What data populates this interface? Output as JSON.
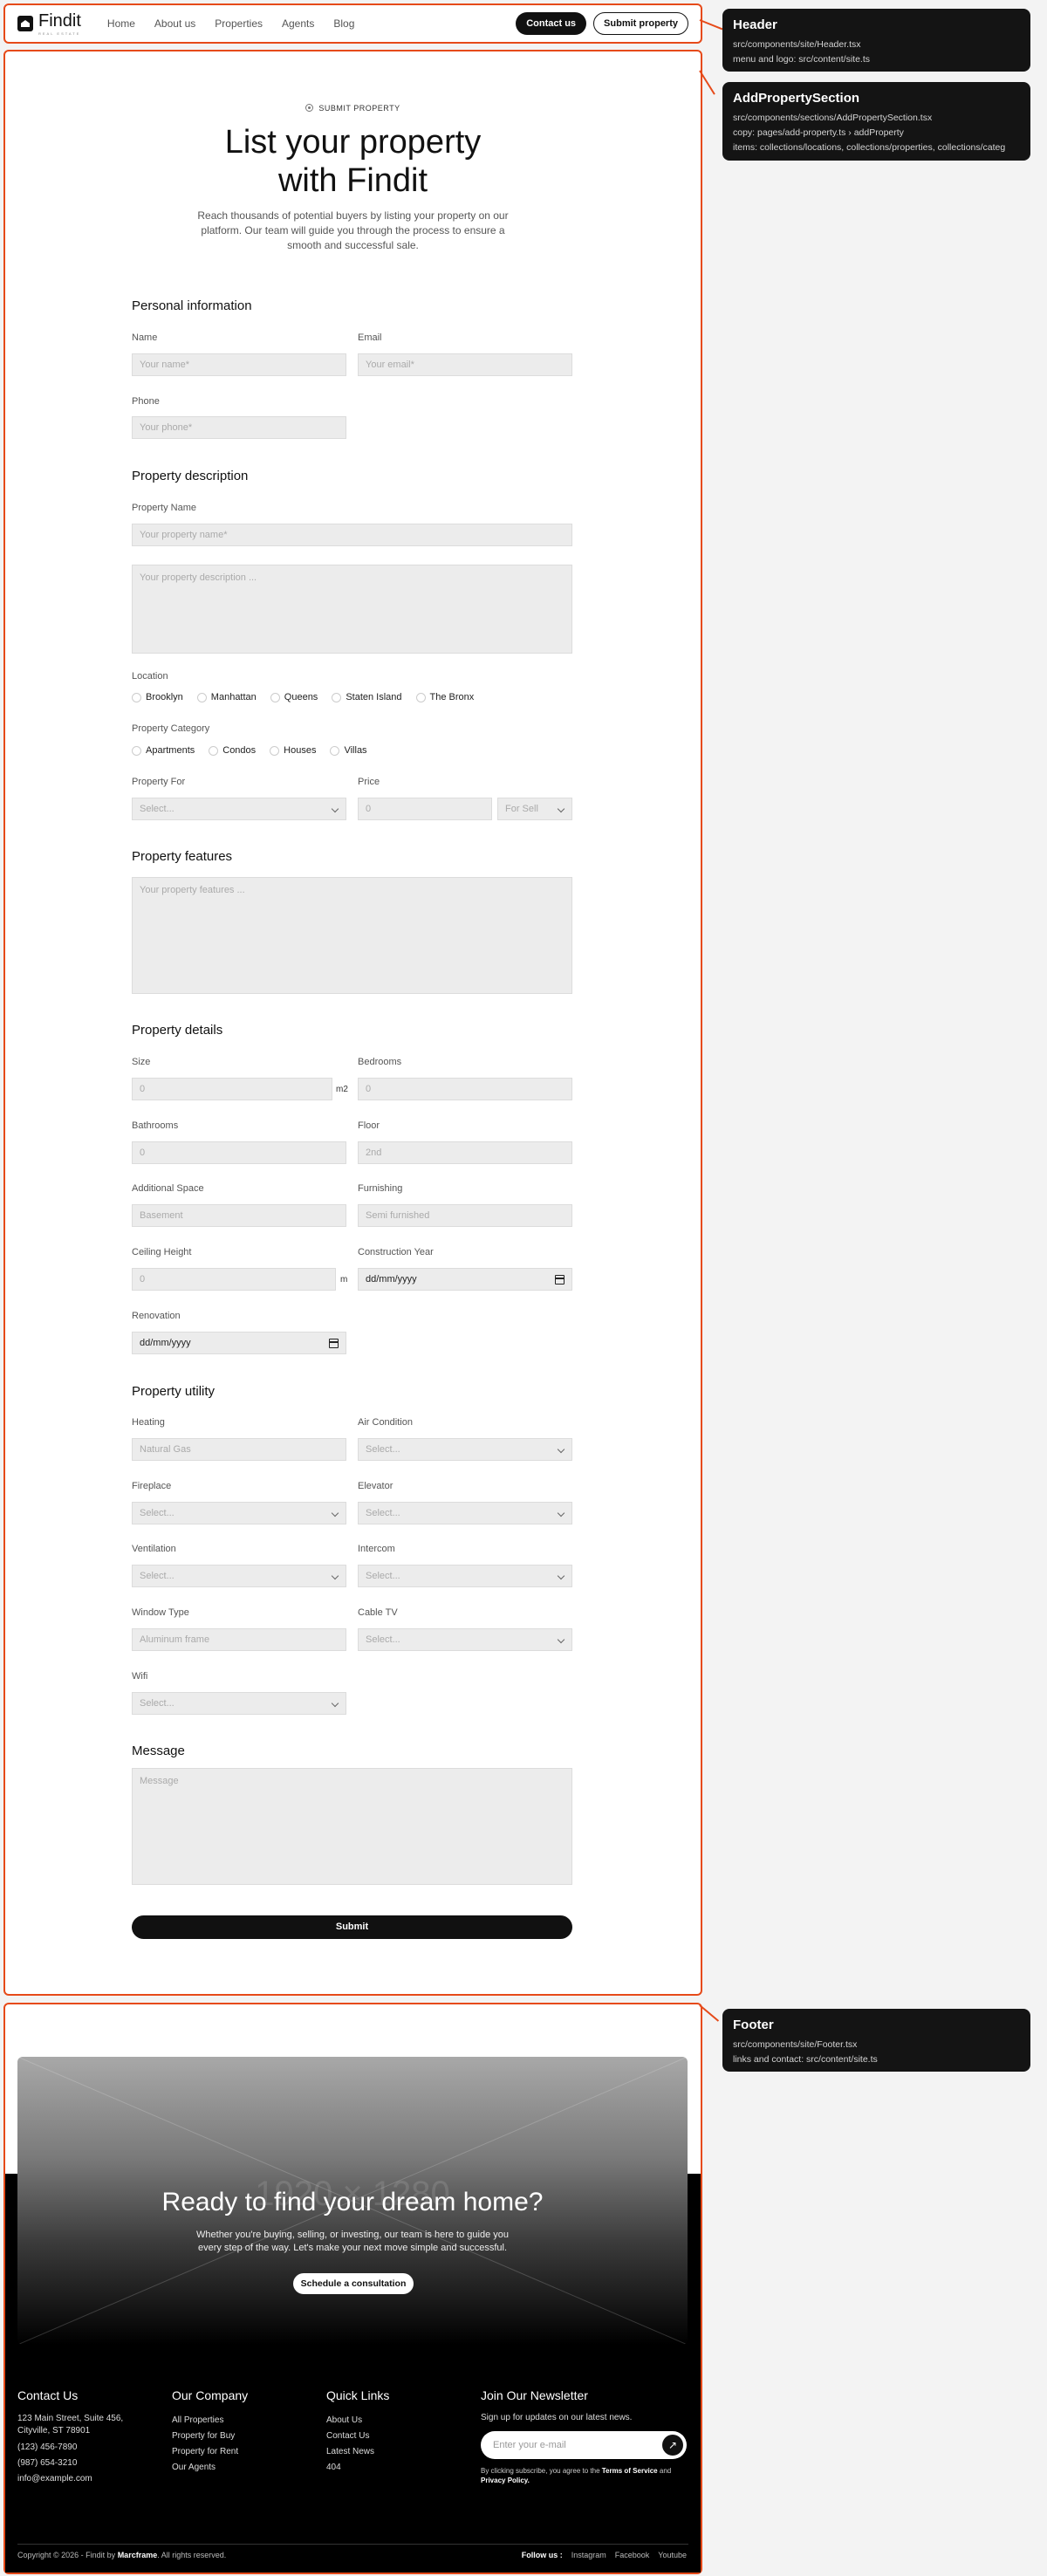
{
  "header": {
    "logo": "Findit",
    "logo_tagline": "REAL ESTATE",
    "nav": [
      "Home",
      "About us",
      "Properties",
      "Agents",
      "Blog"
    ],
    "contact_btn": "Contact us",
    "submit_btn": "Submit property"
  },
  "hero": {
    "eyebrow": "SUBMIT PROPERTY",
    "title_line1": "List your property",
    "title_line2": "with Findit",
    "lede": "Reach thousands of potential buyers by listing your property on our platform. Our team will guide you through the process to ensure a smooth and successful sale."
  },
  "personal": {
    "heading": "Personal information",
    "name_label": "Name",
    "name_ph": "Your name*",
    "email_label": "Email",
    "email_ph": "Your email*",
    "phone_label": "Phone",
    "phone_ph": "Your phone*"
  },
  "description": {
    "heading": "Property description",
    "pname_label": "Property Name",
    "pname_ph": "Your property name*",
    "desc_ph": "Your property description ...",
    "location_label": "Location",
    "locations": [
      "Brooklyn",
      "Manhattan",
      "Queens",
      "Staten Island",
      "The Bronx"
    ],
    "category_label": "Property Category",
    "categories": [
      "Apartments",
      "Condos",
      "Houses",
      "Villas"
    ],
    "for_label": "Property For",
    "for_value": "Select...",
    "price_label": "Price",
    "price_ph": "0",
    "price_mode": "For Sell"
  },
  "features": {
    "heading": "Property features",
    "ph": "Your property features ..."
  },
  "details": {
    "heading": "Property details",
    "size_label": "Size",
    "size_ph": "0",
    "size_unit": "m2",
    "bedrooms_label": "Bedrooms",
    "bedrooms_ph": "0",
    "bathrooms_label": "Bathrooms",
    "bathrooms_ph": "0",
    "floor_label": "Floor",
    "floor_ph": "2nd",
    "space_label": "Additional Space",
    "space_ph": "Basement",
    "furnishing_label": "Furnishing",
    "furnishing_ph": "Semi furnished",
    "ceiling_label": "Ceiling Height",
    "ceiling_ph": "0",
    "ceiling_unit": "m",
    "year_label": "Construction Year",
    "year_ph": "dd/mm/yyyy",
    "renovation_label": "Renovation",
    "renovation_ph": "dd/mm/yyyy"
  },
  "utility": {
    "heading": "Property utility",
    "heating_label": "Heating",
    "heating_ph": "Natural Gas",
    "ac_label": "Air Condition",
    "ac_value": "Select...",
    "fireplace_label": "Fireplace",
    "fireplace_value": "Select...",
    "elevator_label": "Elevator",
    "elevator_value": "Select...",
    "ventilation_label": "Ventilation",
    "ventilation_value": "Select...",
    "intercom_label": "Intercom",
    "intercom_value": "Select...",
    "window_label": "Window Type",
    "window_ph": "Aluminum frame",
    "cable_label": "Cable TV",
    "cable_value": "Select...",
    "wifi_label": "Wifi",
    "wifi_value": "Select..."
  },
  "message": {
    "heading": "Message",
    "ph": "Message",
    "submit": "Submit"
  },
  "cta": {
    "ghost": "1920 × 1280",
    "title": "Ready to find your dream home?",
    "text": "Whether you're buying, selling, or investing, our team is here to guide you every step of the way. Let's make your next move simple and successful.",
    "button": "Schedule a consultation"
  },
  "footer": {
    "contact_h": "Contact Us",
    "contact": [
      "123 Main Street, Suite 456,",
      "Cityville, ST 78901",
      "(123) 456-7890",
      "(987) 654-3210",
      "info@example.com"
    ],
    "company_h": "Our Company",
    "company": [
      "All Properties",
      "Property for Buy",
      "Property for Rent",
      "Our Agents"
    ],
    "links_h": "Quick Links",
    "links": [
      "About Us",
      "Contact Us",
      "Latest News",
      "404"
    ],
    "news_h": "Join Our Newsletter",
    "news_p": "Sign up for updates on our latest news.",
    "news_ph": "Enter your e-mail",
    "news_terms_a": "By clicking subscribe, you agree to the ",
    "news_terms_b": "Terms of Service",
    "news_terms_c": " and ",
    "news_terms_d": "Privacy Policy.",
    "copy_a": "Copyright © 2026 - Findit by ",
    "copy_b": "Marcframe",
    "copy_c": ". All rights reserved.",
    "follow": "Follow us :",
    "social": [
      "Instagram",
      "Facebook",
      "Youtube"
    ]
  },
  "annotations": [
    {
      "title": "Header",
      "lines": [
        "src/components/site/Header.tsx",
        "menu and logo: src/content/site.ts"
      ]
    },
    {
      "title": "AddPropertySection",
      "lines": [
        "src/components/sections/AddPropertySection.tsx",
        "copy: pages/add-property.ts › addProperty",
        "items: collections/locations, collections/properties, collections/categ"
      ]
    },
    {
      "title": "Footer",
      "lines": [
        "src/components/site/Footer.tsx",
        "links and contact: src/content/site.ts"
      ]
    }
  ],
  "colors": {
    "outline": "#e64a19",
    "annotation_bg": "#141414",
    "button": "#111111"
  }
}
